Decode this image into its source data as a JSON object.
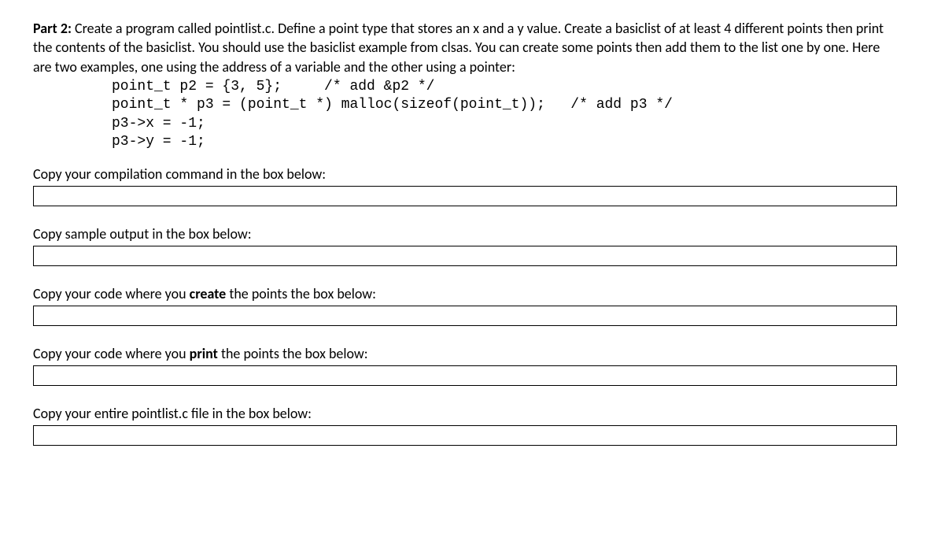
{
  "intro": {
    "part_label": "Part 2:",
    "text": " Create a program called pointlist.c.  Define a point type that stores an x and a y value.  Create a basiclist of at least 4 different points then print the contents of the basiclist.  You should use the basiclist example from clsas.  You can create some points then add them to the list one by one.  Here are two examples, one using the address of a variable and the other using a pointer:"
  },
  "code": "point_t p2 = {3, 5};     /* add &p2 */\npoint_t * p3 = (point_t *) malloc(sizeof(point_t));   /* add p3 */\np3->x = -1;\np3->y = -1;",
  "sections": {
    "compile": {
      "label": "Copy your compilation command in the box below:",
      "value": ""
    },
    "output": {
      "label": "Copy sample output in the box below:",
      "value": ""
    },
    "create": {
      "label_pre": "Copy your code where you ",
      "label_bold": "create",
      "label_post": " the points the box below:",
      "value": ""
    },
    "print": {
      "label_pre": "Copy your code where you ",
      "label_bold": "print",
      "label_post": " the points the box below:",
      "value": ""
    },
    "file": {
      "label": "Copy your entire pointlist.c file in the box below:",
      "value": ""
    }
  }
}
